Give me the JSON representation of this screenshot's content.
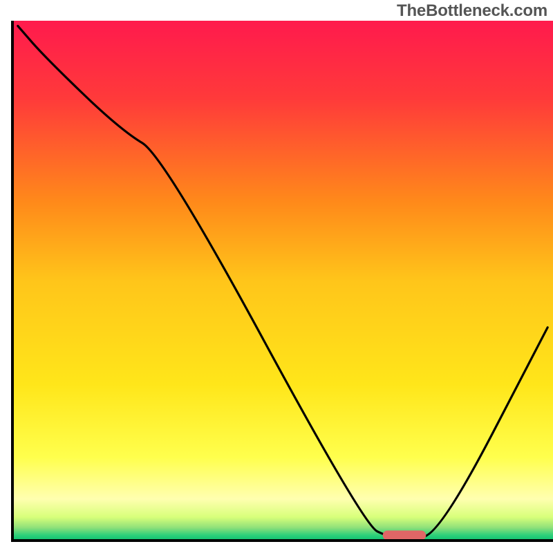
{
  "watermark": "TheBottleneck.com",
  "chart_data": {
    "type": "line",
    "title": "",
    "xlabel": "",
    "ylabel": "",
    "xlim": [
      0,
      100
    ],
    "ylim": [
      0,
      100
    ],
    "series": [
      {
        "name": "bottleneck-curve",
        "x": [
          1,
          6,
          20,
          28,
          65,
          70,
          73,
          79,
          99
        ],
        "values": [
          99,
          93,
          79,
          74,
          3,
          0.5,
          0.5,
          1,
          41
        ]
      }
    ],
    "marker": {
      "name": "optimal-marker",
      "x_center": 72.5,
      "width": 8,
      "y": 1,
      "color": "#e06666"
    },
    "background_gradient": {
      "stops": [
        {
          "offset": 0.0,
          "color": "#ff1a4d"
        },
        {
          "offset": 0.15,
          "color": "#ff3a3a"
        },
        {
          "offset": 0.35,
          "color": "#ff8a1a"
        },
        {
          "offset": 0.5,
          "color": "#ffc51a"
        },
        {
          "offset": 0.7,
          "color": "#ffe61a"
        },
        {
          "offset": 0.84,
          "color": "#ffff4d"
        },
        {
          "offset": 0.92,
          "color": "#ffffb0"
        },
        {
          "offset": 0.955,
          "color": "#d8ff7a"
        },
        {
          "offset": 0.975,
          "color": "#8fe07a"
        },
        {
          "offset": 0.99,
          "color": "#2bcf7a"
        },
        {
          "offset": 1.0,
          "color": "#0fbf6f"
        }
      ]
    }
  }
}
